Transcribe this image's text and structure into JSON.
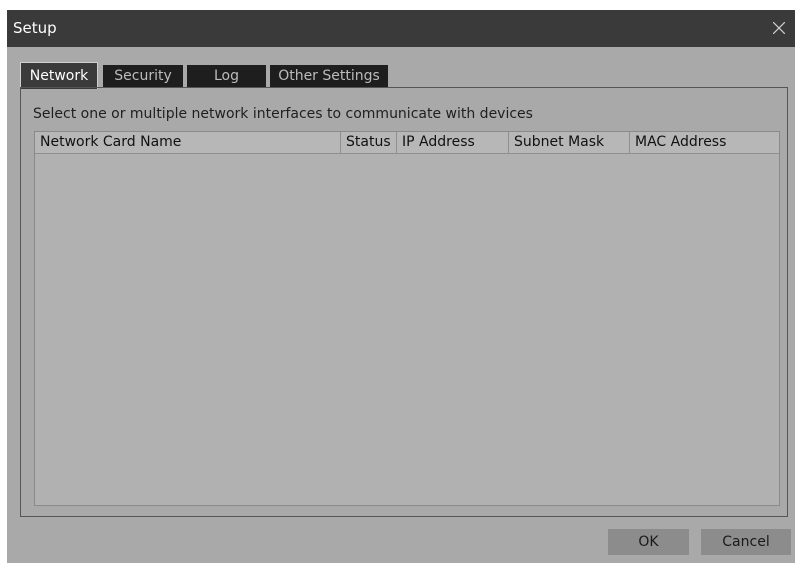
{
  "window": {
    "title": "Setup",
    "close_icon": "close-icon"
  },
  "tabs": [
    {
      "label": "Network",
      "active": true
    },
    {
      "label": "Security",
      "active": false
    },
    {
      "label": "Log",
      "active": false
    },
    {
      "label": "Other Settings",
      "active": false
    }
  ],
  "network": {
    "instructions": "Select one or multiple network interfaces to communicate with devices",
    "table": {
      "columns": [
        "Network Card Name",
        "Status",
        "IP Address",
        "Subnet Mask",
        "MAC Address"
      ],
      "rows": []
    }
  },
  "buttons": {
    "ok": "OK",
    "cancel": "Cancel"
  },
  "colors": {
    "title_bar": "#3a3a3a",
    "window_bg": "#a9a9a9",
    "tab_inactive": "#1e1e1e",
    "tab_active": "#3a3a3a",
    "button_bg": "#8c8c8c"
  }
}
